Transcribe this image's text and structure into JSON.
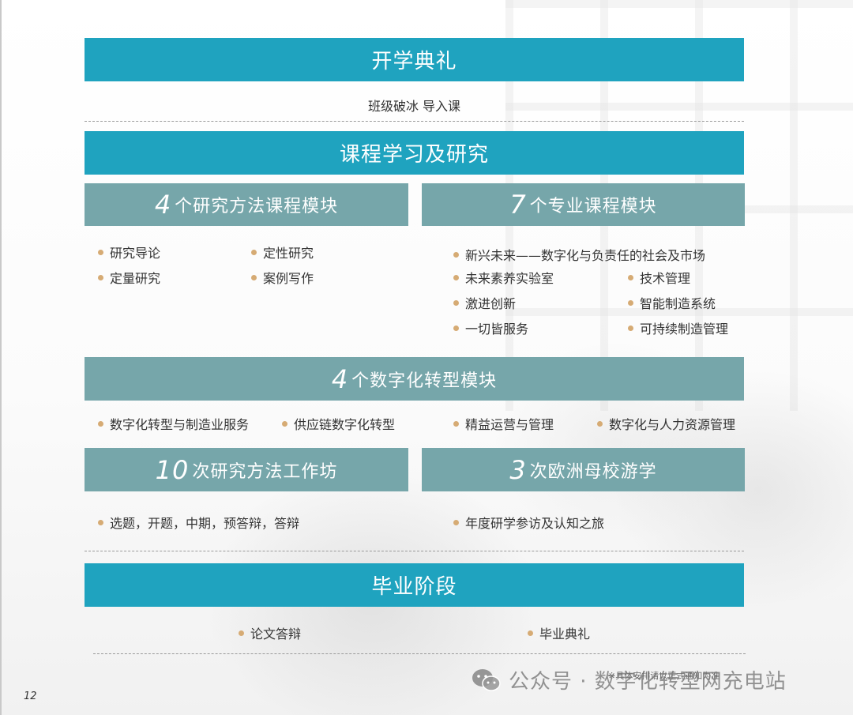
{
  "opening": {
    "title": "开学典礼",
    "subtitle": "班级破冰 导入课"
  },
  "study": {
    "title": "课程学习及研究",
    "research_module": {
      "num": "4",
      "label": "个研究方法课程模块",
      "items": [
        "研究导论",
        "定性研究",
        "定量研究",
        "案例写作"
      ]
    },
    "professional_module": {
      "num": "7",
      "label": " 个专业课程模块",
      "items": [
        "新兴未来——数字化与负责任的社会及市场",
        "未来素养实验室",
        "技术管理",
        "激进创新",
        "智能制造系统",
        "一切皆服务",
        "可持续制造管理"
      ]
    },
    "digital_module": {
      "num": "4",
      "label": " 个数字化转型模块",
      "items": [
        "数字化转型与制造业服务",
        "供应链数字化转型",
        "精益运营与管理",
        "数字化与人力资源管理"
      ]
    },
    "workshop": {
      "num": "10",
      "label": "次研究方法工作坊",
      "items": [
        "选题，开题，中期，预答辩，答辩"
      ]
    },
    "europe": {
      "num": "3",
      "label": "次欧洲母校游学",
      "items": [
        "年度研学参访及认知之旅"
      ]
    }
  },
  "graduation": {
    "title": "毕业阶段",
    "items": [
      "论文答辩",
      "毕业典礼"
    ]
  },
  "footer": {
    "note": "※具体安排请以正式通知为准",
    "page_number": "12",
    "watermark": "公众号 · 数字化转型网充电站"
  },
  "colors": {
    "primary_bar": "#1fa3bf",
    "secondary_bar": "#76a6aa",
    "bullet": "#d6ab74"
  }
}
